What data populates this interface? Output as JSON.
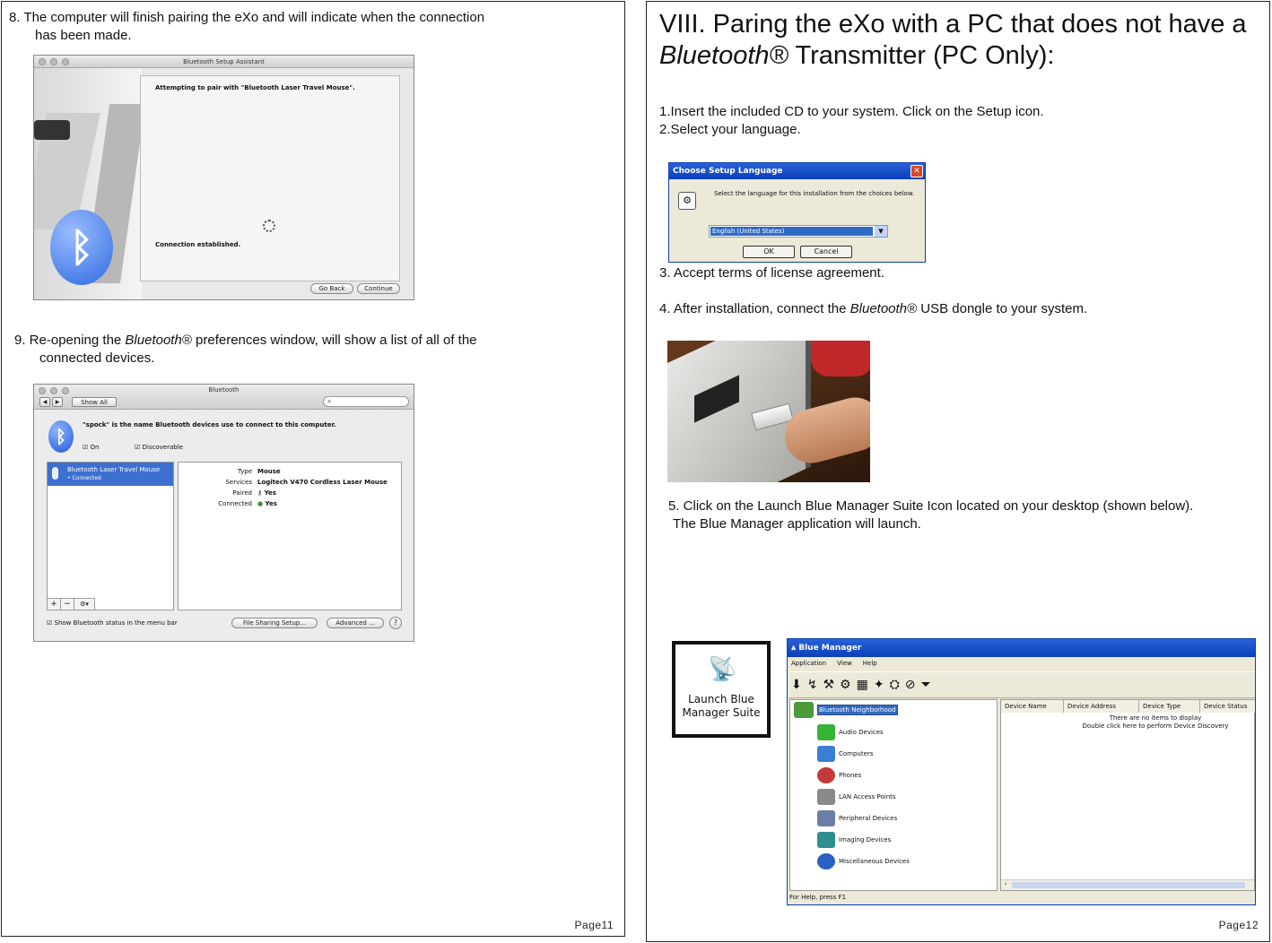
{
  "left_page": {
    "step8": {
      "line1": "8. The computer will finish pairing the eXo and will indicate when the connection",
      "line2": "has been made."
    },
    "pairing_window": {
      "title": "Bluetooth Setup Assistant",
      "heading": "Attempting to pair with \"Bluetooth Laser Travel Mouse\".",
      "status": "Connection established.",
      "back_button": "Go Back",
      "continue_button": "Continue",
      "icon": "bluetooth-icon"
    },
    "step9": {
      "prefix": "9.  Re-opening the ",
      "brand": "Bluetooth®",
      "suffix": " preferences window, will show a list of all of the",
      "line2": "connected devices."
    },
    "prefs_window": {
      "title": "Bluetooth",
      "show_all": "Show All",
      "name_line": "\"spock\" is the name Bluetooth devices use to connect to this computer.",
      "on_label": "On",
      "discoverable_label": "Discoverable",
      "device_name": "Bluetooth Laser Travel Mouse",
      "device_status": "Connected",
      "details": [
        {
          "key": "Type",
          "value": "Mouse"
        },
        {
          "key": "Services",
          "value": "Logitech V470 Cordless Laser Mouse"
        },
        {
          "key": "Paired",
          "value": "Yes"
        },
        {
          "key": "Connected",
          "value": "Yes"
        }
      ],
      "add": "+",
      "remove": "−",
      "gear": "⚙▾",
      "show_status_label": "Show Bluetooth status in the menu bar",
      "file_sharing_button": "File Sharing Setup...",
      "advanced_button": "Advanced ...",
      "help": "?"
    },
    "page_number": "Page11"
  },
  "right_page": {
    "heading": {
      "line1": "VIII. Paring the eXo with a PC that does not have a",
      "brand": "Bluetooth®",
      "line2_rest": " Transmitter (PC Only):"
    },
    "step1": "1.Insert the included CD to your system. Click on the Setup icon.",
    "step2": "2.Select your language.",
    "language_dialog": {
      "title": "Choose Setup Language",
      "instruction": "Select the language for this installation from the choices below.",
      "selected": "English (United States)",
      "ok": "OK",
      "cancel": "Cancel",
      "close": "✕"
    },
    "step3": "3. Accept terms of license agreement.",
    "step4": {
      "prefix": "4. After installation, connect the ",
      "brand": "Bluetooth®",
      "suffix": " USB dongle to your system."
    },
    "step5": {
      "line1": "5. Click on the Launch Blue Manager Suite Icon located on your desktop (shown below).",
      "line2": "The Blue Manager  application will launch."
    },
    "desktop_icon": {
      "line1": "Launch Blue",
      "line2": "Manager Suite"
    },
    "blue_manager": {
      "title": "Blue Manager",
      "menu": [
        "Application",
        "View",
        "Help"
      ],
      "root": "Bluetooth Neighborhood",
      "tree": [
        "Audio Devices",
        "Computers",
        "Phones",
        "LAN Access Points",
        "Peripheral Devices",
        "Imaging Devices",
        "Miscellaneous Devices"
      ],
      "columns": [
        "Device Name",
        "Device Address",
        "Device Type",
        "Device Status"
      ],
      "empty1": "There are no items to display",
      "empty2": "Double click here to perform Device Discovery",
      "statusbar": "For Help, press F1"
    },
    "page_number": "Page12"
  }
}
